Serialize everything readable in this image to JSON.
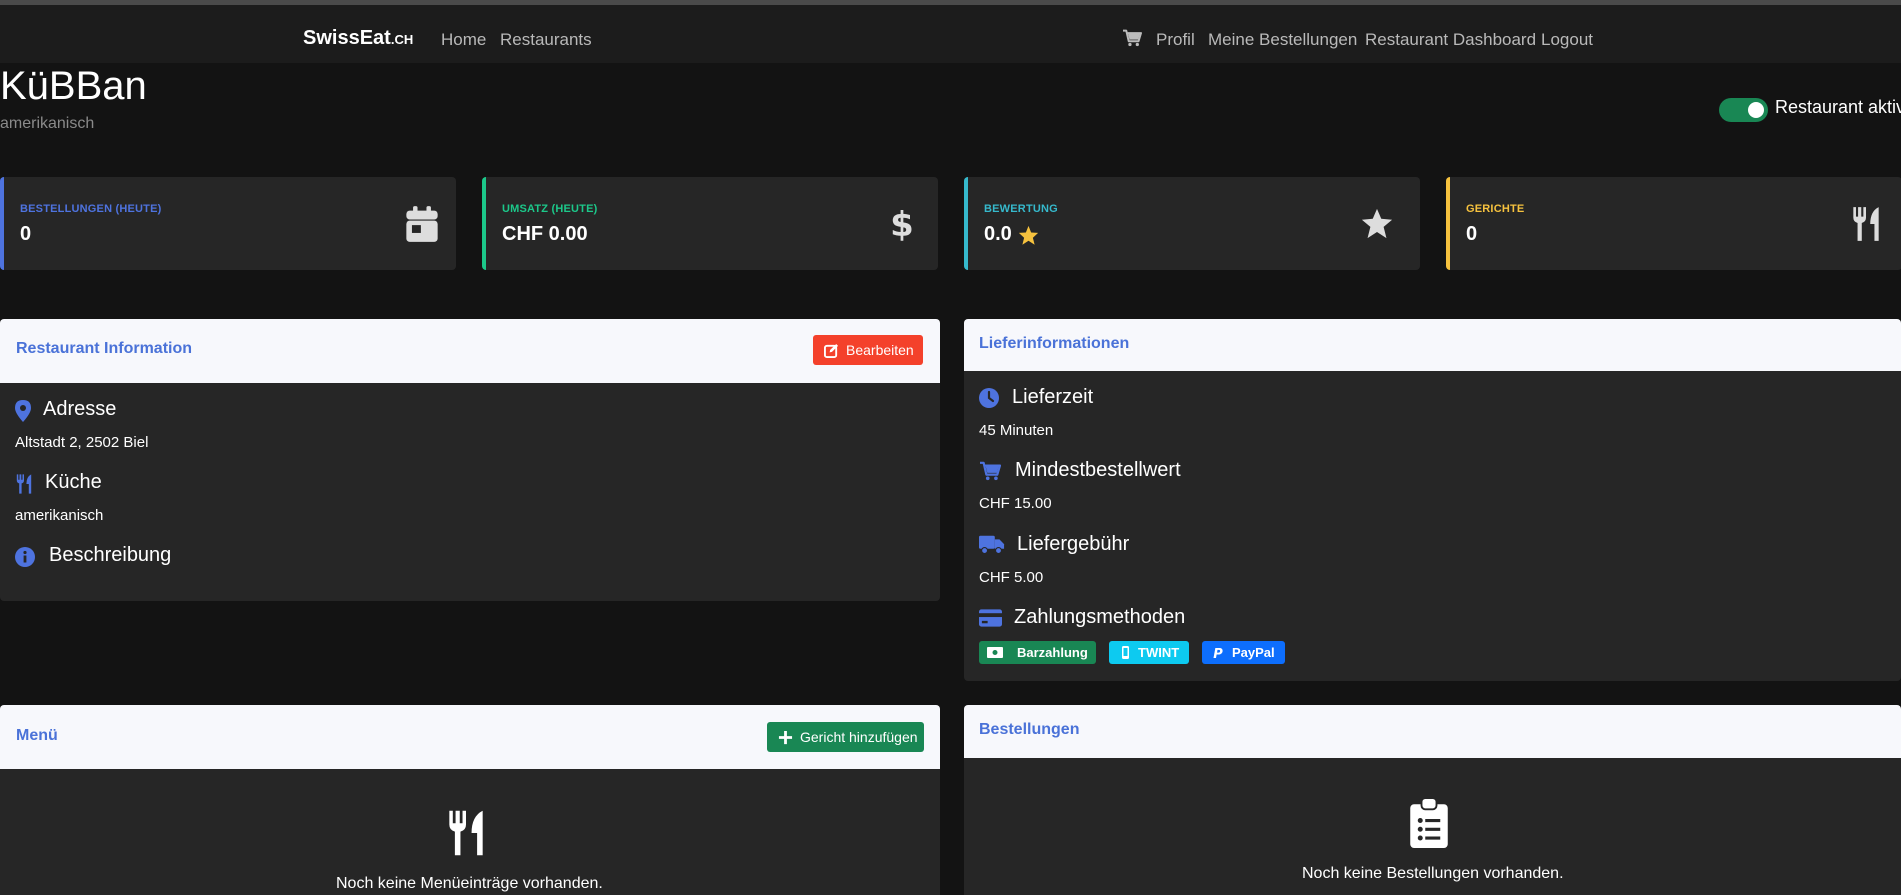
{
  "navbar": {
    "brand_main": "SwissEat",
    "brand_suffix": ".CH",
    "left_links": [
      "Home",
      "Restaurants"
    ],
    "right_links": [
      "Profil",
      "Meine Bestellungen",
      "Restaurant Dashboard",
      "Logout"
    ],
    "cart_icon": "shopping-cart-icon"
  },
  "restaurant": {
    "name": "KüBBan",
    "cuisine": "amerikanisch",
    "active_label": "Restaurant aktiv",
    "active": true
  },
  "stats": [
    {
      "label": "BESTELLUNGEN (HEUTE)",
      "value": "0",
      "icon": "calendar-icon",
      "color": "#4e73df"
    },
    {
      "label": "UMSATZ (HEUTE)",
      "value": "CHF 0.00",
      "icon": "dollar-icon",
      "color": "#1cc88a"
    },
    {
      "label": "BEWERTUNG",
      "value": "0.0",
      "icon": "star-icon",
      "color": "#36b9cc"
    },
    {
      "label": "GERICHTE",
      "value": "0",
      "icon": "utensils-icon",
      "color": "#f6c23e"
    }
  ],
  "info_card": {
    "title": "Restaurant Information",
    "edit_label": "Bearbeiten",
    "address_title": "Adresse",
    "address": "Altstadt 2, 2502 Biel",
    "kitchen_title": "Küche",
    "kitchen": "amerikanisch",
    "description_title": "Beschreibung"
  },
  "delivery_card": {
    "title": "Lieferinformationen",
    "time_title": "Lieferzeit",
    "time": "45 Minuten",
    "min_title": "Mindestbestellwert",
    "min": "CHF 15.00",
    "fee_title": "Liefergebühr",
    "fee": "CHF 5.00",
    "payment_title": "Zahlungsmethoden",
    "payments": [
      {
        "label": "Barzahlung",
        "color": "#198754",
        "icon": "cash-icon"
      },
      {
        "label": "TWINT",
        "color": "#0dcaf0",
        "icon": "mobile-icon"
      },
      {
        "label": "PayPal",
        "color": "#0d6efd",
        "icon": "paypal-icon"
      }
    ]
  },
  "menu_card": {
    "title": "Menü",
    "add_label": "Gericht hinzufügen",
    "empty": "Noch keine Menüeinträge vorhanden."
  },
  "orders_card": {
    "title": "Bestellungen",
    "empty": "Noch keine Bestellungen vorhanden."
  },
  "colors": {
    "accent": "#4a72d8",
    "danger": "#f4412b",
    "success": "#198754",
    "background": "#131313",
    "card": "#262626"
  }
}
